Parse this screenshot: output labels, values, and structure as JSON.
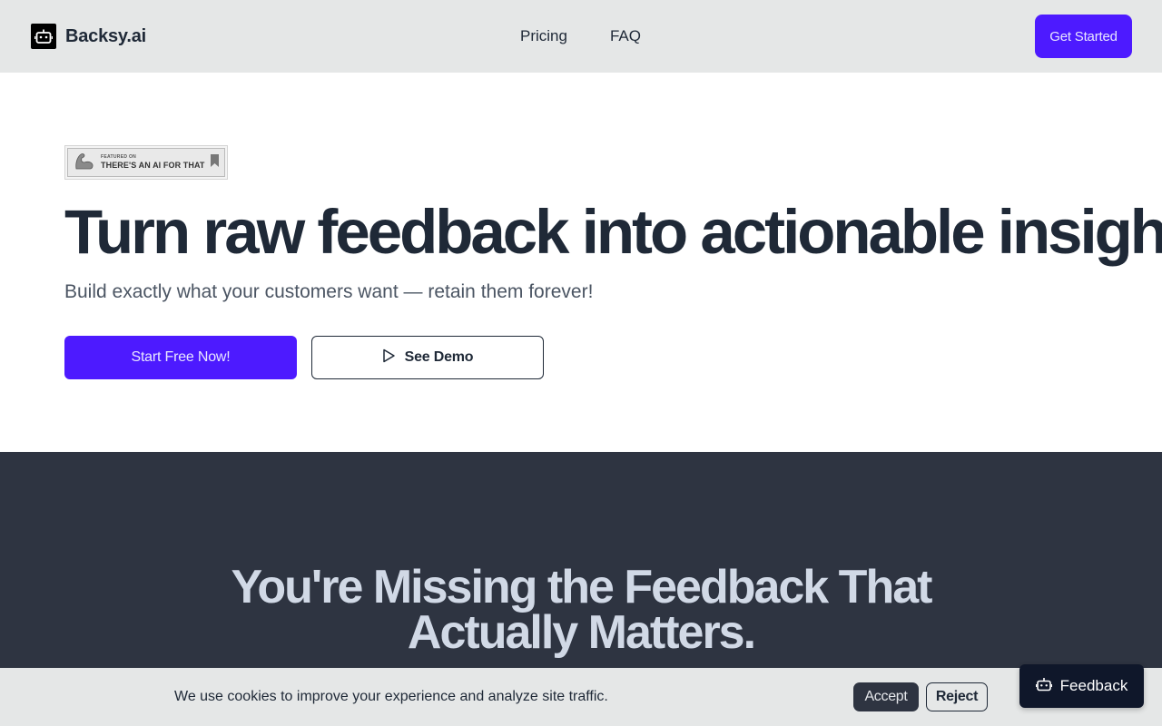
{
  "header": {
    "brand_name": "Backsy.ai",
    "nav": [
      "Pricing",
      "FAQ"
    ],
    "cta_label": "Get Started"
  },
  "hero": {
    "badge": {
      "small_text": "FEATURED ON",
      "big_text": "THERE'S AN AI FOR THAT"
    },
    "title": "Turn raw feedback into actionable insights",
    "subtitle": "Build exactly what your customers want — retain them forever!",
    "primary_button": "Start Free Now!",
    "demo_button": "See Demo"
  },
  "section": {
    "title": "You're Missing the Feedback That Actually Matters."
  },
  "cookie": {
    "message": "We use cookies to improve your experience and analyze site traffic.",
    "accept_label": "Accept",
    "reject_label": "Reject"
  },
  "feedback_widget": {
    "label": "Feedback"
  },
  "colors": {
    "accent": "#4d1aff",
    "header_bg": "#e5e7e7",
    "dark_section_bg": "#2e3441",
    "text_dark": "#1f2937"
  },
  "icons": [
    "robot-icon",
    "play-icon",
    "muscle-arm-icon",
    "bookmark-icon"
  ]
}
